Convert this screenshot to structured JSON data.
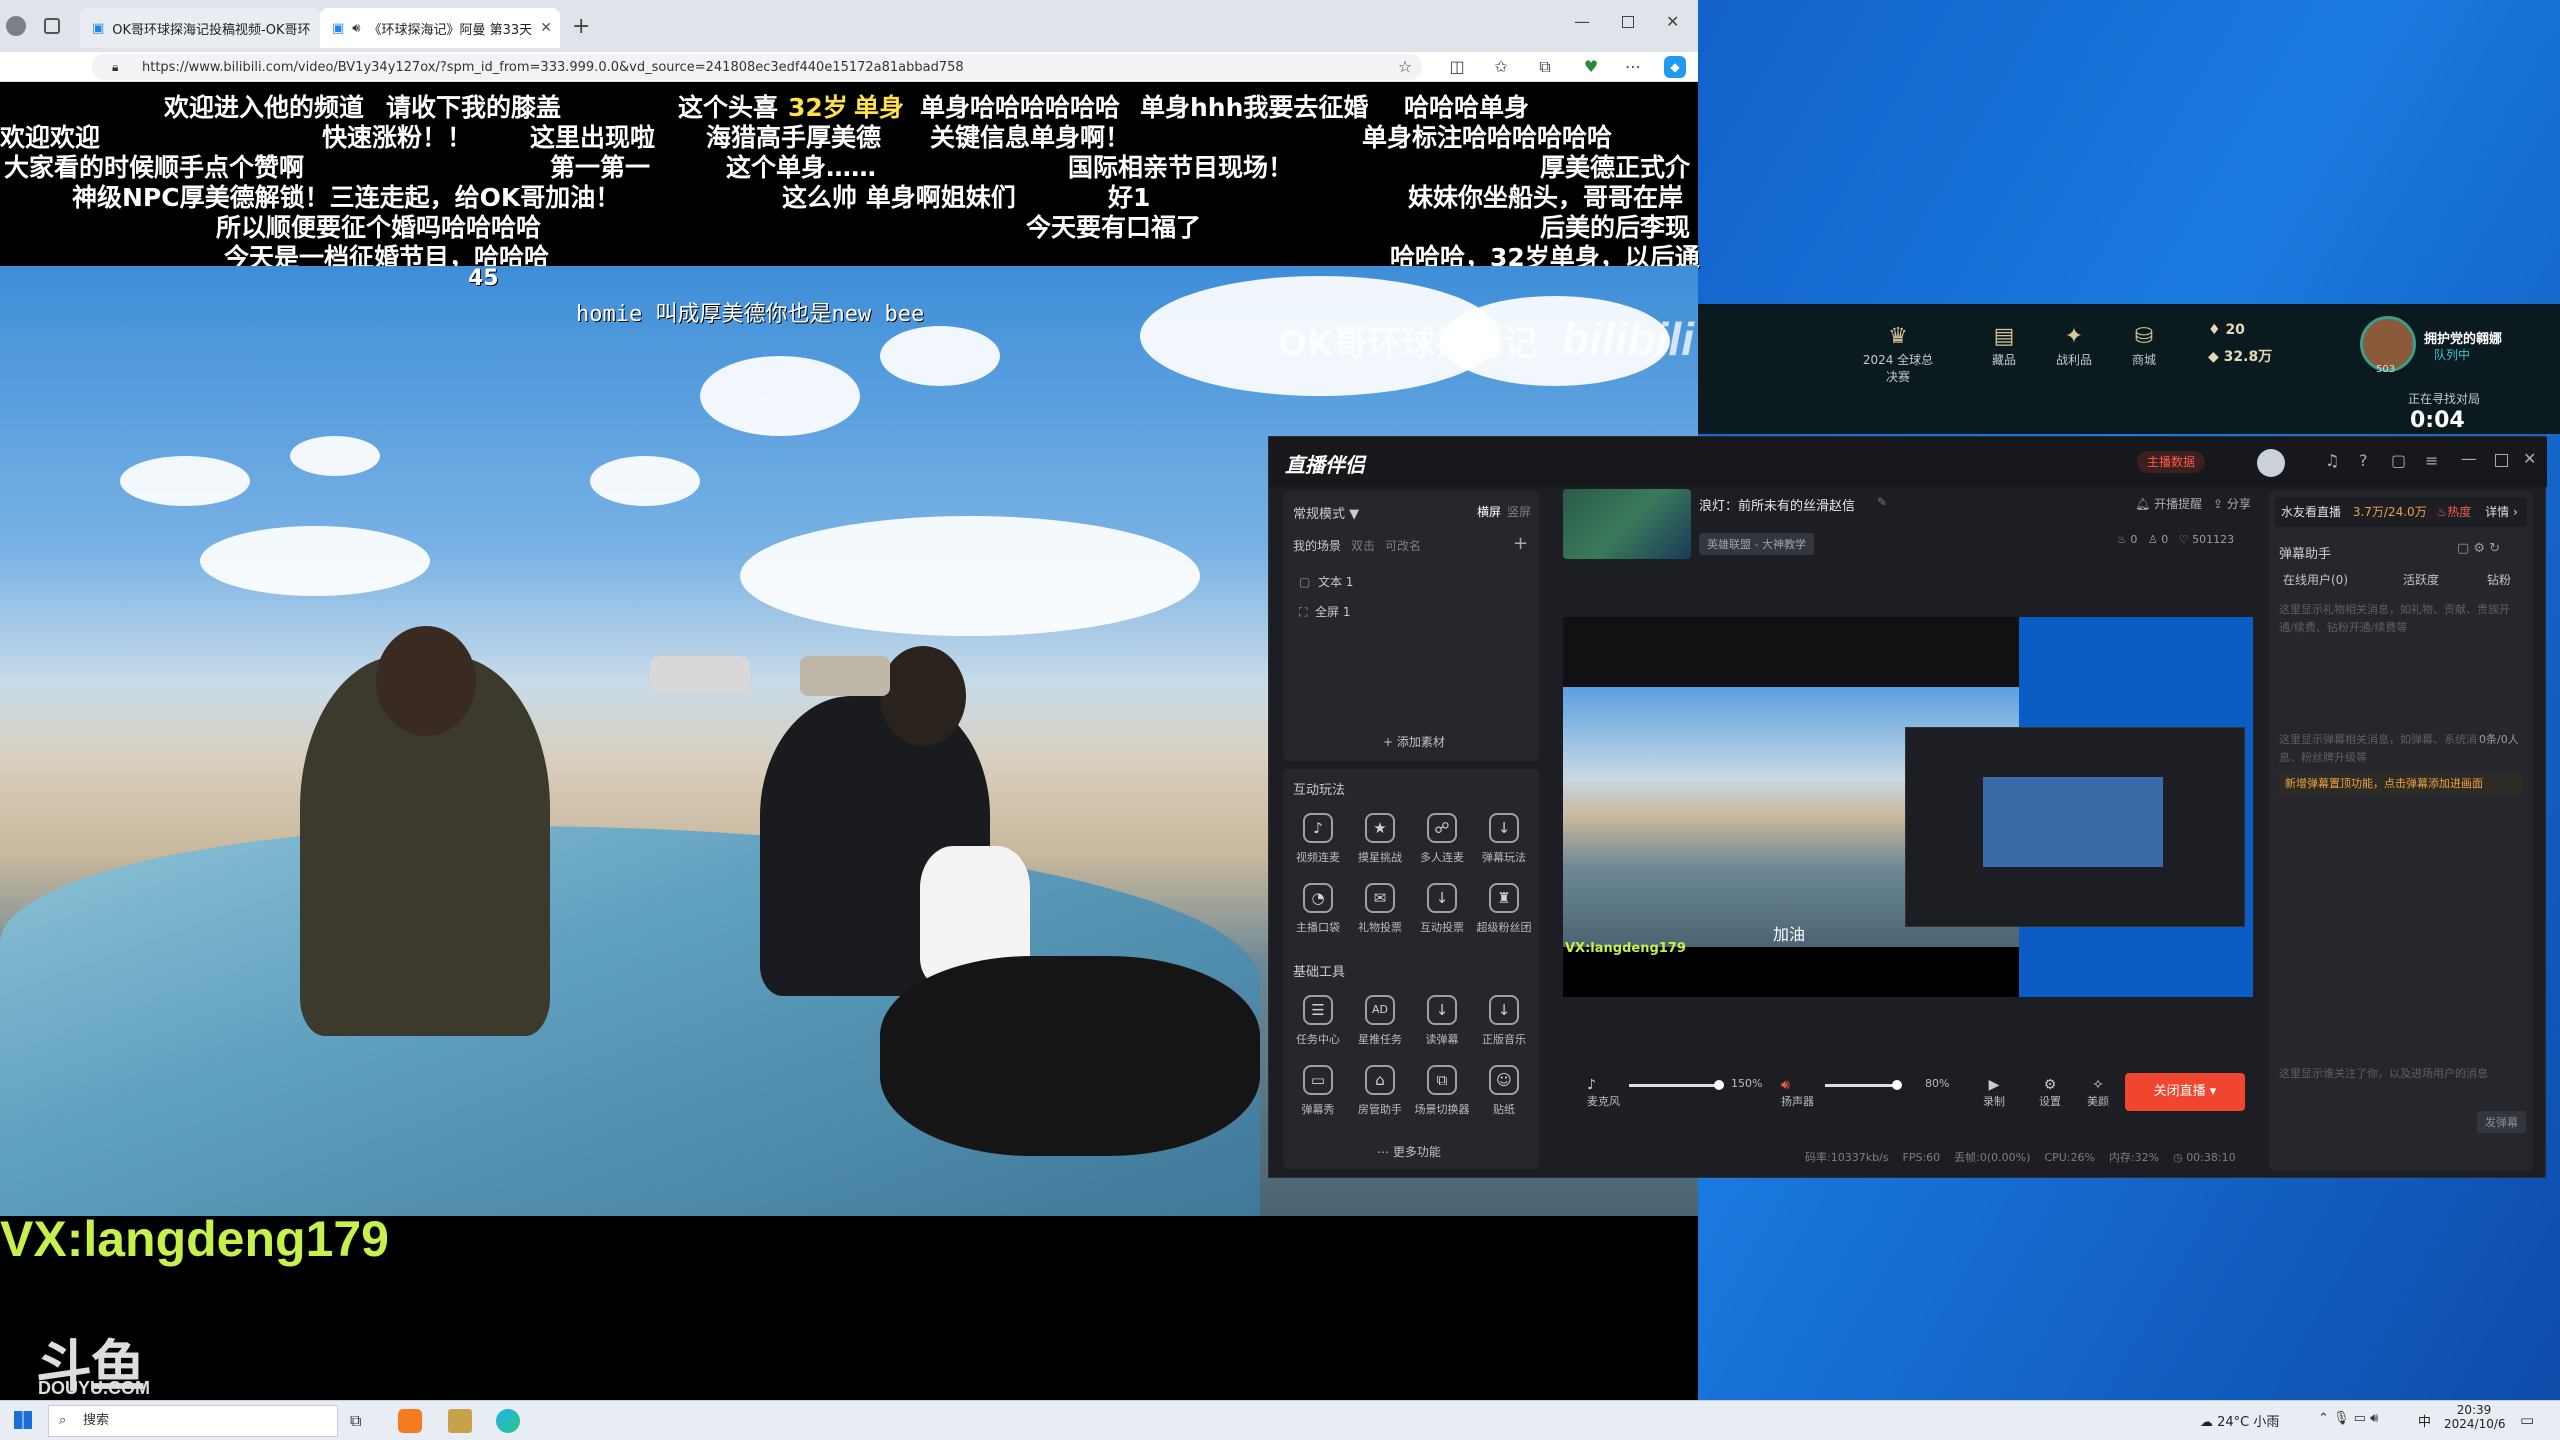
{
  "browser": {
    "tabs": [
      {
        "title": "OK哥环球探海记投稿视频-OK哥环"
      },
      {
        "title": "《环球探海记》阿曼 第33天"
      }
    ],
    "url": "https://www.bilibili.com/video/BV1y34y127ox/?spm_id_from=333.999.0.0&vd_source=241808ec3edf440e15172a81abbad758"
  },
  "video": {
    "danmaku": [
      "欢迎进入他的频道",
      "请收下我的膝盖",
      "这个头喜",
      "32岁",
      "单身",
      "单身哈哈哈哈哈哈",
      "单身hhh我要去征婚",
      "哈哈哈单身",
      "欢迎欢迎",
      "快速涨粉！！",
      "这里出现啦",
      "海猎高手厚美德",
      "关键信息单身啊！",
      "单身标注哈哈哈哈哈哈",
      "大家看的时候顺手点个赞啊",
      "第一第一",
      "这个单身……",
      "国际相亲节目现场！",
      "厚美德正式介",
      "神级NPC厚美德解锁！三连走起，给OK哥加油！",
      "这么帅 单身啊姐妹们",
      "好1",
      "妹妹你坐船头，哥哥在岸",
      "所以顺便要征个婚吗哈哈哈哈",
      "今天要有口福了",
      "后美的后李现",
      "今天是一档征婚节目，哈哈哈",
      "哈哈哈，32岁单身，以后通",
      "45",
      "homie 叫成厚美德你也是new bee"
    ],
    "watermark": "OK哥环球探海记",
    "watermark_logo": "bilibili",
    "vx": "VX:langdeng179",
    "douyu": "斗鱼",
    "douyu_sub": "DOUYU.COM"
  },
  "game": {
    "nav": [
      "2024 全球总决赛",
      "藏品",
      "战利品",
      "商城"
    ],
    "currency1": "20",
    "currency2": "32.8万",
    "level": "503",
    "player_name": "拥护党的翱娜",
    "player_status": "队列中",
    "matchmaking": "正在寻找对局",
    "timer": "0:04"
  },
  "app": {
    "logo": "直播伴侣",
    "host_data": "主播数据",
    "mode": "常规模式",
    "orientation": [
      "横屏",
      "竖屏"
    ],
    "scene_tabs": [
      "我的场景",
      "双击",
      "可改名"
    ],
    "sources": [
      "文本 1",
      "全屏 1"
    ],
    "add_source": "添加素材",
    "interact_title": "互动玩法",
    "interact_tools": [
      "视频连麦",
      "摸星挑战",
      "多人连麦",
      "弹幕玩法",
      "主播口袋",
      "礼物投票",
      "互动投票",
      "超级粉丝团"
    ],
    "base_title": "基础工具",
    "base_tools": [
      "任务中心",
      "星推任务",
      "读弹幕",
      "正版音乐",
      "弹幕秀",
      "房管助手",
      "场景切换器",
      "贴纸"
    ],
    "more": "更多功能",
    "stream_title": "浪灯：前所未有的丝滑赵信",
    "stream_category": "英雄联盟 - 大神教学",
    "notify": "开播提醒",
    "share": "分享",
    "stats": [
      "0",
      "0",
      "501123"
    ],
    "preview_vx": "VX:langdeng179",
    "preview_caption": "加油",
    "mic_label": "麦克风",
    "mic_value": "150%",
    "speaker_label": "扬声器",
    "speaker_value": "80%",
    "ctrl": [
      "录制",
      "设置",
      "美颜"
    ],
    "stop_button": "关闭直播",
    "status_bar": [
      "码率:10337kb/s",
      "FPS:60",
      "丢帧:0(0.00%)",
      "CPU:26%",
      "内存:32%",
      "00:38:10"
    ],
    "side_tabs_top": "水友看直播",
    "side_count": "3.7万/24.0万",
    "side_hot": "热度",
    "side_detail": "详情",
    "assistant_title": "弹幕助手",
    "assistant_tabs": [
      "在线用户(0)",
      "活跃度",
      "钻粉"
    ],
    "assistant_hint1": "这里显示礼物相关消息，如礼物、贡献、贵族开通/续费、钻粉开通/续费等",
    "assistant_hint2": "这里显示弹幕相关消息，如弹幕、系统消息、粉丝牌升级等",
    "assistant_rate": "0条/0人",
    "assistant_link": "新增弹幕置顶功能，点击弹幕添加进画面",
    "assistant_hint3": "这里显示谁关注了你，以及进场用户的消息",
    "send_danmu": "发弹幕"
  },
  "taskbar": {
    "search": "搜索",
    "weather": "24°C 小雨",
    "ime": "中",
    "time": "20:39",
    "date": "2024/10/6"
  }
}
